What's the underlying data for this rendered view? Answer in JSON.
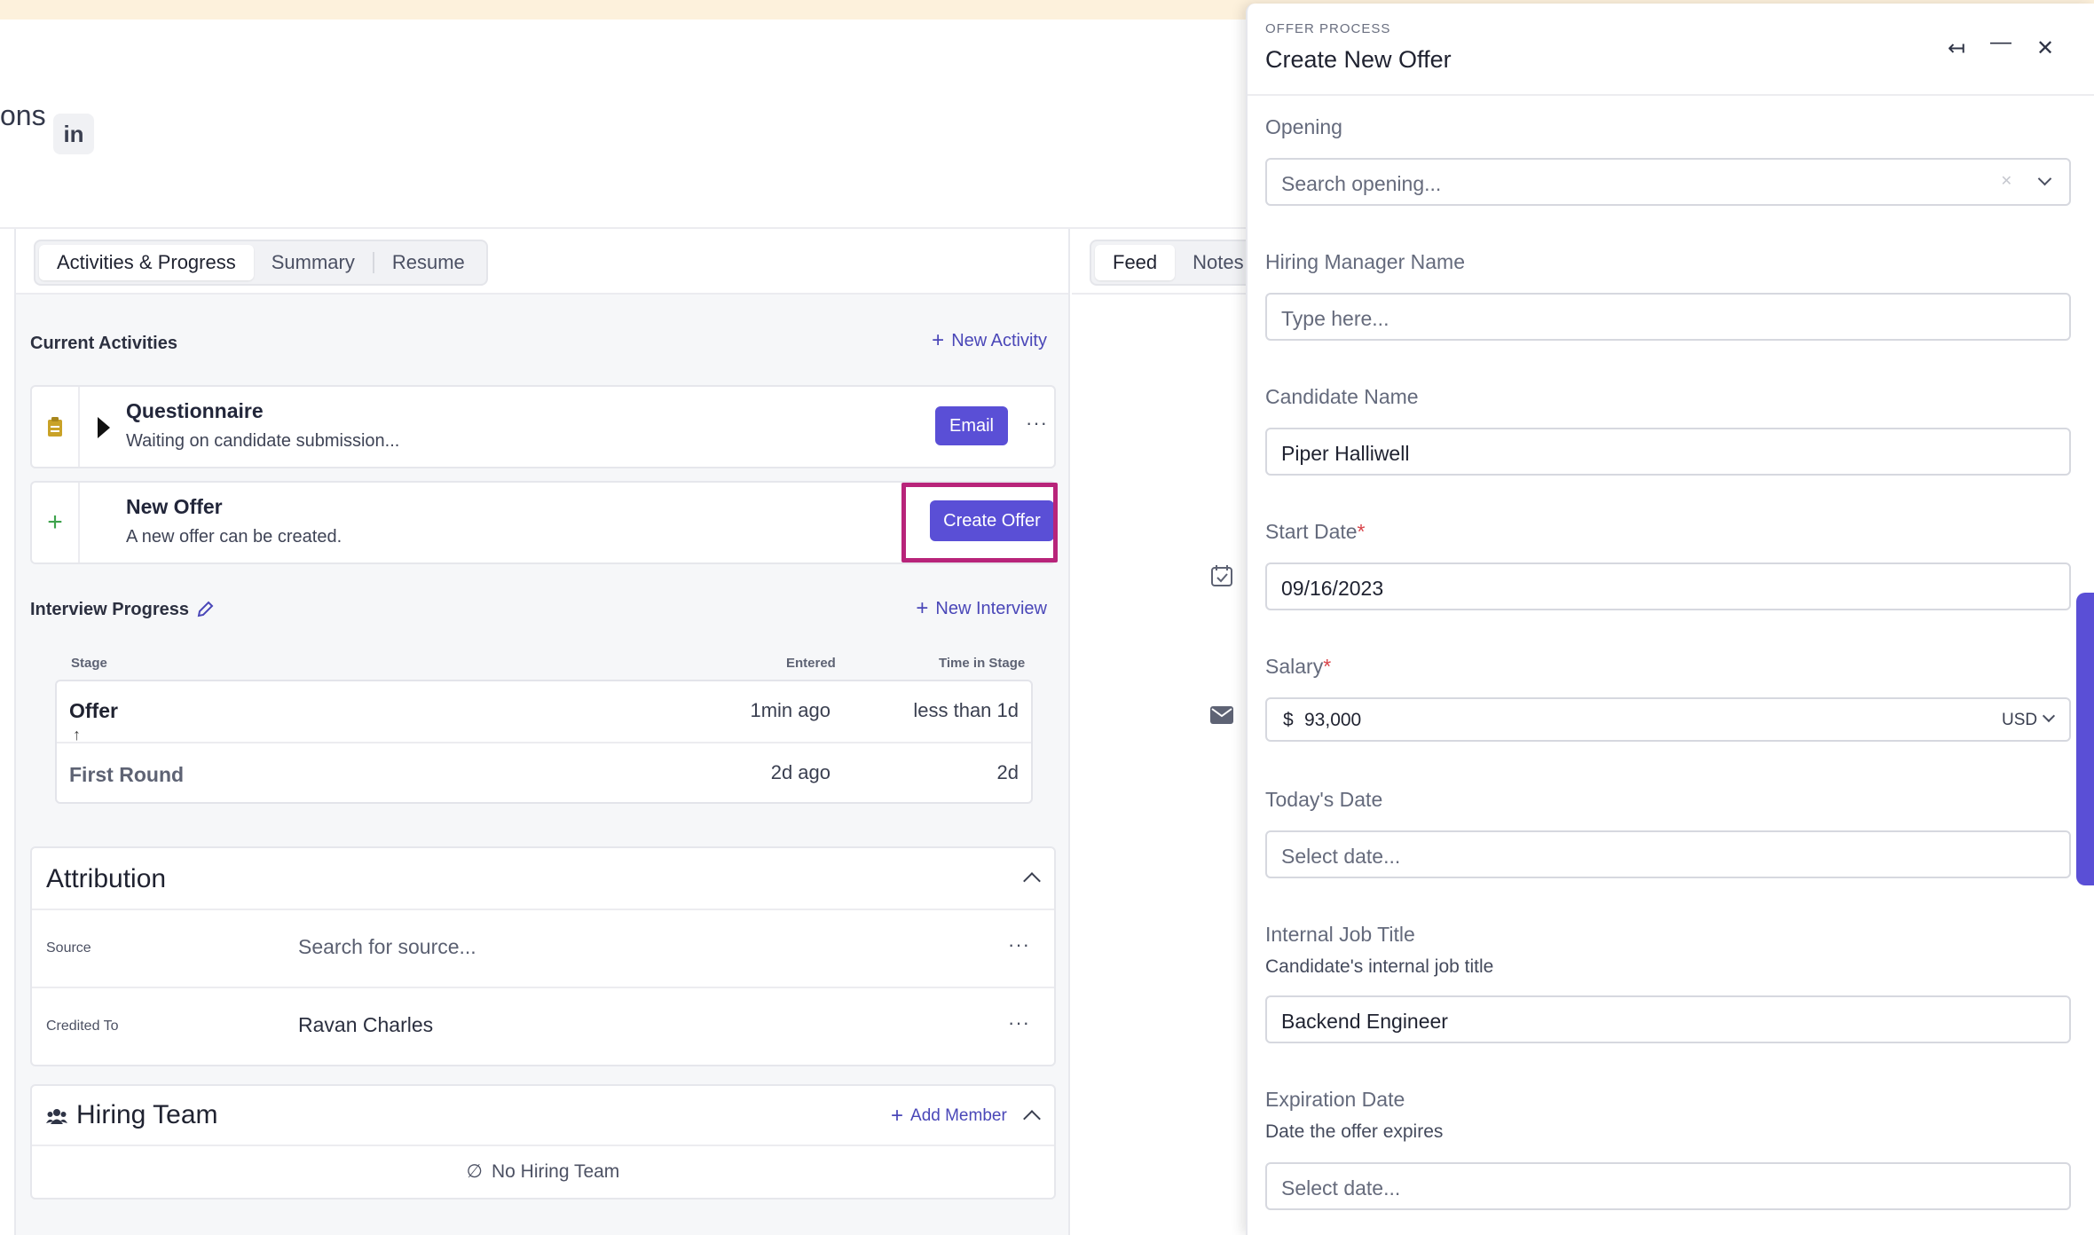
{
  "header": {
    "name_fragment": "ons",
    "linkedin_label": "in"
  },
  "left_tabs": [
    "Activities & Progress",
    "Summary",
    "Resume"
  ],
  "feed_tabs": [
    "Feed",
    "Notes"
  ],
  "current_activities": {
    "title": "Current Activities",
    "new_activity": "New Activity",
    "items": [
      {
        "title": "Questionnaire",
        "subtitle": "Waiting on candidate submission...",
        "action": "Email"
      },
      {
        "title": "New Offer",
        "subtitle": "A new offer can be created.",
        "action": "Create Offer"
      }
    ]
  },
  "interview_progress": {
    "title": "Interview Progress",
    "new_interview": "New Interview",
    "columns": {
      "stage": "Stage",
      "entered": "Entered",
      "time": "Time in Stage"
    },
    "rows": [
      {
        "stage": "Offer",
        "entered": "1min ago",
        "time": "less than 1d"
      },
      {
        "stage": "First Round",
        "entered": "2d ago",
        "time": "2d"
      }
    ]
  },
  "attribution": {
    "title": "Attribution",
    "source_label": "Source",
    "source_placeholder": "Search for source...",
    "credited_label": "Credited To",
    "credited_value": "Ravan Charles"
  },
  "hiring_team": {
    "title": "Hiring Team",
    "add_member": "Add Member",
    "empty": "No Hiring Team"
  },
  "modal": {
    "overline": "OFFER PROCESS",
    "title": "Create New Offer",
    "fields": {
      "opening": {
        "label": "Opening",
        "placeholder": "Search opening..."
      },
      "hiring_manager": {
        "label": "Hiring Manager Name",
        "placeholder": "Type here..."
      },
      "candidate": {
        "label": "Candidate Name",
        "value": "Piper Halliwell"
      },
      "start_date": {
        "label": "Start Date",
        "required": "*",
        "value": "09/16/2023"
      },
      "salary": {
        "label": "Salary",
        "required": "*",
        "currency_symbol": "$",
        "value": "93,000",
        "currency": "USD"
      },
      "todays_date": {
        "label": "Today's Date",
        "placeholder": "Select date..."
      },
      "internal_title": {
        "label": "Internal Job Title",
        "help": "Candidate's internal job title",
        "value": "Backend Engineer"
      },
      "expiration": {
        "label": "Expiration Date",
        "help": "Date the offer expires",
        "placeholder": "Select date..."
      }
    }
  },
  "colors": {
    "accent": "#5a4fd6",
    "highlight": "#b8247a",
    "banner": "#fdf1dc"
  }
}
